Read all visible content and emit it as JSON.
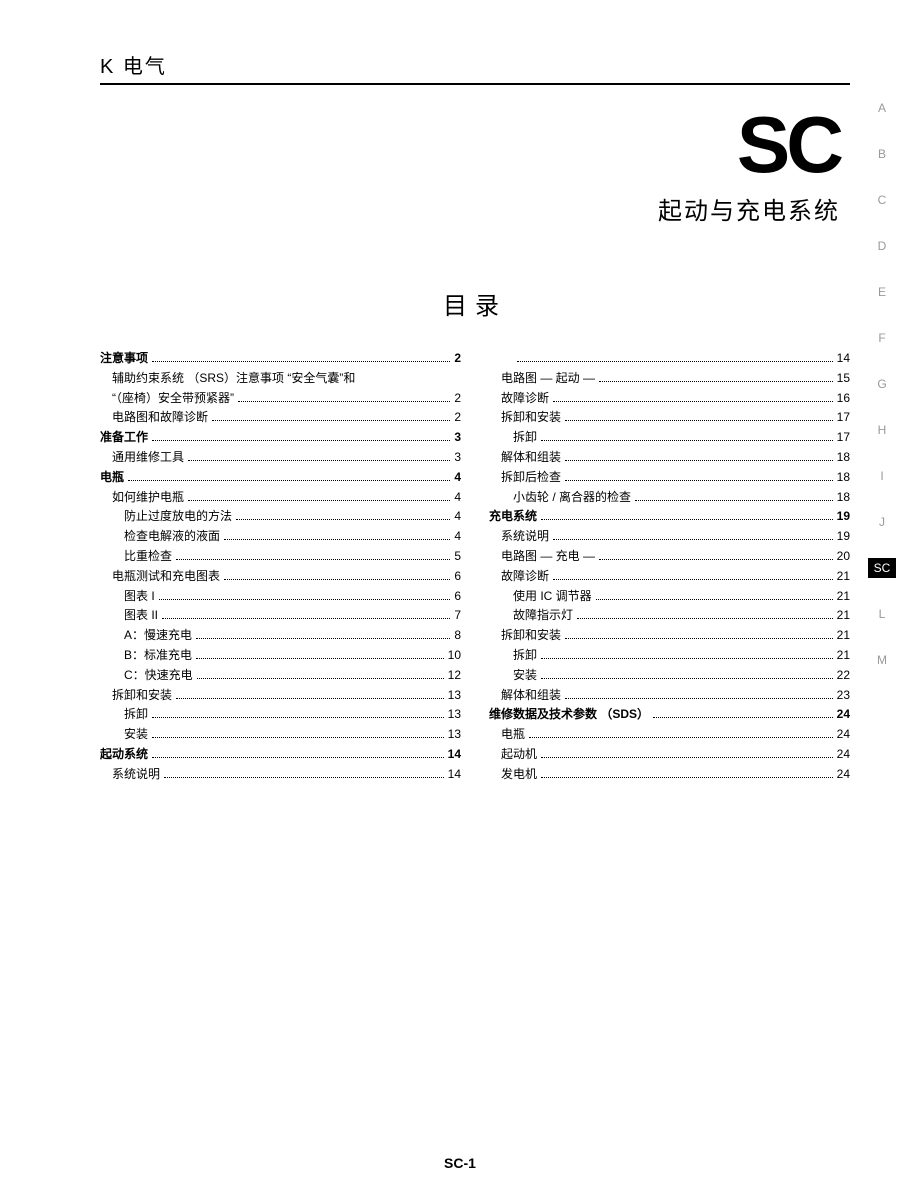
{
  "header": {
    "category": "K 电气",
    "code": "SC",
    "title": "起动与充电系统"
  },
  "tocTitle": "目录",
  "sideTabs": [
    "A",
    "B",
    "C",
    "D",
    "E",
    "F",
    "G",
    "H",
    "I",
    "J",
    "SC",
    "L",
    "M"
  ],
  "activeTab": "SC",
  "footer": "SC-1",
  "left": [
    {
      "l": "注意事项",
      "p": "2",
      "i": 0
    },
    {
      "l": "辅助约束系统 （SRS）注意事项 “安全气囊”和",
      "p": "",
      "i": 1,
      "nodots": true
    },
    {
      "l": "“（座椅）安全带预紧器”",
      "p": "2",
      "i": 1
    },
    {
      "l": "电路图和故障诊断",
      "p": "2",
      "i": 1
    },
    {
      "l": "准备工作",
      "p": "3",
      "i": 0
    },
    {
      "l": "通用维修工具",
      "p": "3",
      "i": 1
    },
    {
      "l": "电瓶",
      "p": "4",
      "i": 0
    },
    {
      "l": "如何维护电瓶",
      "p": "4",
      "i": 1
    },
    {
      "l": "防止过度放电的方法",
      "p": "4",
      "i": 2
    },
    {
      "l": "检查电解液的液面",
      "p": "4",
      "i": 2
    },
    {
      "l": "比重检查",
      "p": "5",
      "i": 2
    },
    {
      "l": "电瓶测试和充电图表",
      "p": "6",
      "i": 1
    },
    {
      "l": "图表 I",
      "p": "6",
      "i": 2
    },
    {
      "l": "图表 II",
      "p": "7",
      "i": 2
    },
    {
      "l": "A：慢速充电",
      "p": "8",
      "i": 2
    },
    {
      "l": "B：标准充电",
      "p": "10",
      "i": 2
    },
    {
      "l": "C：快速充电",
      "p": "12",
      "i": 2
    },
    {
      "l": "拆卸和安装",
      "p": "13",
      "i": 1
    },
    {
      "l": "拆卸",
      "p": "13",
      "i": 2
    },
    {
      "l": "安装",
      "p": "13",
      "i": 2
    },
    {
      "l": "起动系统",
      "p": "14",
      "i": 0
    },
    {
      "l": "系统说明",
      "p": "14",
      "i": 1
    }
  ],
  "right": [
    {
      "l": "",
      "p": "14",
      "i": 2
    },
    {
      "l": "电路图 — 起动 —",
      "p": "15",
      "i": 1
    },
    {
      "l": "故障诊断",
      "p": "16",
      "i": 1
    },
    {
      "l": "拆卸和安装",
      "p": "17",
      "i": 1
    },
    {
      "l": "拆卸",
      "p": "17",
      "i": 2
    },
    {
      "l": "解体和组装",
      "p": "18",
      "i": 1
    },
    {
      "l": "拆卸后检查",
      "p": "18",
      "i": 1
    },
    {
      "l": "小齿轮 / 离合器的检查",
      "p": "18",
      "i": 2
    },
    {
      "l": "充电系统",
      "p": "19",
      "i": 0
    },
    {
      "l": "系统说明",
      "p": "19",
      "i": 1
    },
    {
      "l": "电路图 — 充电 —",
      "p": "20",
      "i": 1
    },
    {
      "l": "故障诊断",
      "p": "21",
      "i": 1
    },
    {
      "l": "使用 IC 调节器",
      "p": "21",
      "i": 2
    },
    {
      "l": "故障指示灯",
      "p": "21",
      "i": 2
    },
    {
      "l": "拆卸和安装",
      "p": "21",
      "i": 1
    },
    {
      "l": "拆卸",
      "p": "21",
      "i": 2
    },
    {
      "l": "安装",
      "p": "22",
      "i": 2
    },
    {
      "l": "解体和组装",
      "p": "23",
      "i": 1
    },
    {
      "l": "维修数据及技术参数 （SDS）",
      "p": "24",
      "i": 0
    },
    {
      "l": "电瓶",
      "p": "24",
      "i": 1
    },
    {
      "l": "起动机",
      "p": "24",
      "i": 1
    },
    {
      "l": "发电机",
      "p": "24",
      "i": 1
    }
  ]
}
